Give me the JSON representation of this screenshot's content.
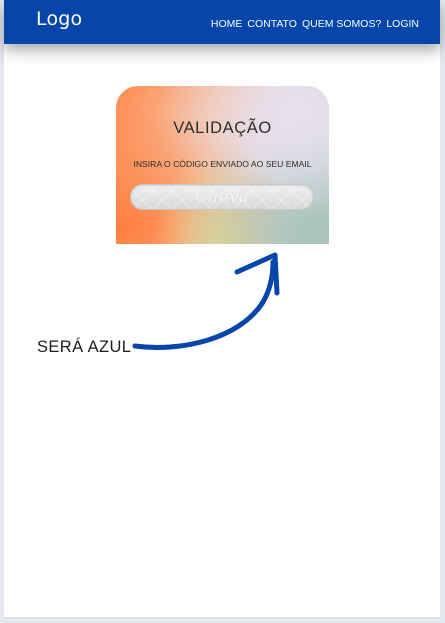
{
  "navbar": {
    "logo": "Logo",
    "links": [
      "HOME",
      "CONTATO",
      "QUEM SOMOS?",
      "LOGIN"
    ],
    "color": "#0646ab"
  },
  "card": {
    "title": "VALIDAÇÃO",
    "subtitle": "INSIRA O CÓDIGO ENVIADO AO SEU EMAIL",
    "watermark": "Canva"
  },
  "annotation": {
    "text": "SERÁ AZUL",
    "arrow_color": "#0646ab",
    "icon": "curved-arrow-icon"
  }
}
